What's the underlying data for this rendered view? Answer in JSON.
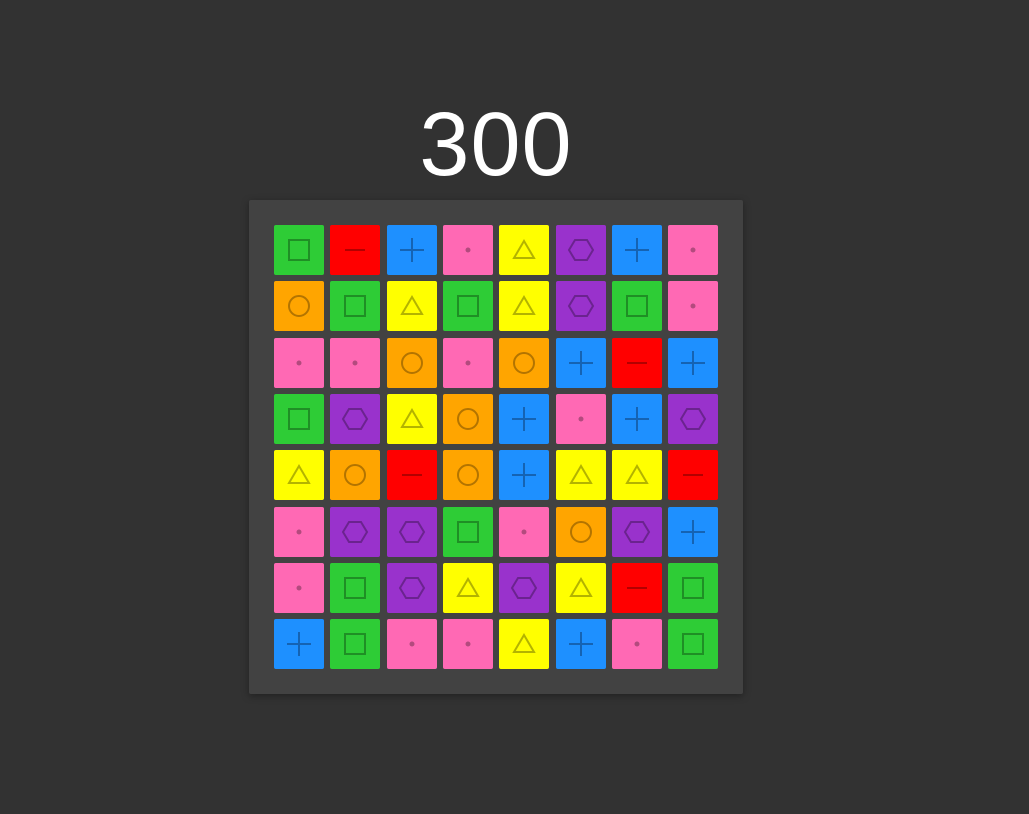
{
  "score": "300",
  "palette": {
    "green": {
      "fill": "#2ecc36",
      "icon": "#1f8f25",
      "shape": "square"
    },
    "red": {
      "fill": "#ff0000",
      "icon": "#b30000",
      "shape": "minus"
    },
    "blue": {
      "fill": "#1e90ff",
      "icon": "#1563b3",
      "shape": "plus"
    },
    "pink": {
      "fill": "#ff69b4",
      "icon": "#b34a7e",
      "shape": "dot"
    },
    "yellow": {
      "fill": "#ffff00",
      "icon": "#b3b300",
      "shape": "triangle"
    },
    "purple": {
      "fill": "#9932cc",
      "icon": "#6b238f",
      "shape": "hexagon"
    },
    "orange": {
      "fill": "#ffa500",
      "icon": "#b37400",
      "shape": "circle"
    }
  },
  "grid": [
    [
      "green",
      "red",
      "blue",
      "pink",
      "yellow",
      "purple",
      "blue",
      "pink"
    ],
    [
      "orange",
      "green",
      "yellow",
      "green",
      "yellow",
      "purple",
      "green",
      "pink"
    ],
    [
      "pink",
      "pink",
      "orange",
      "pink",
      "orange",
      "blue",
      "red",
      "blue"
    ],
    [
      "green",
      "purple",
      "yellow",
      "orange",
      "blue",
      "pink",
      "blue",
      "purple"
    ],
    [
      "yellow",
      "orange",
      "red",
      "orange",
      "blue",
      "yellow",
      "yellow",
      "red"
    ],
    [
      "pink",
      "purple",
      "purple",
      "green",
      "pink",
      "orange",
      "purple",
      "blue"
    ],
    [
      "pink",
      "green",
      "purple",
      "yellow",
      "purple",
      "yellow",
      "red",
      "green"
    ],
    [
      "blue",
      "green",
      "pink",
      "pink",
      "yellow",
      "blue",
      "pink",
      "green"
    ]
  ]
}
